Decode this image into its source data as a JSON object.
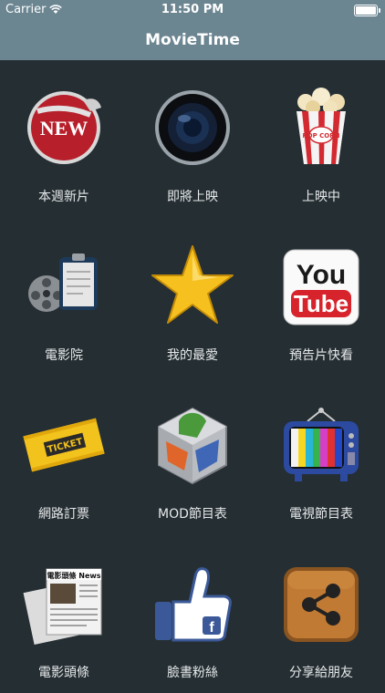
{
  "status_bar": {
    "carrier": "Carrier",
    "time": "11:50 PM"
  },
  "nav": {
    "title": "MovieTime"
  },
  "menu": [
    {
      "label": "本週新片",
      "icon": "new-sticker-icon"
    },
    {
      "label": "即將上映",
      "icon": "camera-lens-icon"
    },
    {
      "label": "上映中",
      "icon": "popcorn-icon"
    },
    {
      "label": "電影院",
      "icon": "film-reel-clipboard-icon"
    },
    {
      "label": "我的最愛",
      "icon": "star-icon"
    },
    {
      "label": "預告片快看",
      "icon": "youtube-icon"
    },
    {
      "label": "網路訂票",
      "icon": "ticket-icon"
    },
    {
      "label": "MOD節目表",
      "icon": "mod-cube-icon"
    },
    {
      "label": "電視節目表",
      "icon": "tv-icon"
    },
    {
      "label": "電影頭條",
      "icon": "newspaper-icon"
    },
    {
      "label": "臉書粉絲",
      "icon": "facebook-like-icon"
    },
    {
      "label": "分享給朋友",
      "icon": "share-icon"
    }
  ],
  "icon_text": {
    "new": "NEW",
    "popcorn": "POP CORN",
    "you": "You",
    "tube": "Tube",
    "ticket": "TICKET",
    "news": "電影頭條 News",
    "facebook": "f"
  }
}
